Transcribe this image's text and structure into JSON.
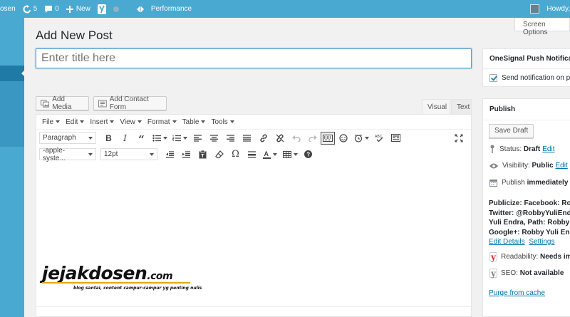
{
  "adminbar": {
    "site_name": "osen",
    "updates_count": "5",
    "comments_count": "0",
    "new_label": "New",
    "performance_label": "Performance",
    "howdy": "Howdy,"
  },
  "screen_options": "Screen Options",
  "page_title": "Add New Post",
  "title_placeholder": "Enter title here",
  "media_buttons": {
    "add_media": "Add Media",
    "add_contact_form": "Add Contact Form"
  },
  "editor_tabs": {
    "visual": "Visual",
    "text": "Text"
  },
  "menubar": [
    "File",
    "Edit",
    "Insert",
    "View",
    "Format",
    "Table",
    "Tools"
  ],
  "toolbar": {
    "format_select": "Paragraph",
    "font_family": "-apple-syste...",
    "font_size": "12pt"
  },
  "logo": {
    "brand": "jejakdosen",
    "tld": ".com",
    "tagline": "blog santai, content campur-campur yg penting nulis"
  },
  "onesignal": {
    "title": "OneSignal Push Notificat",
    "checkbox_label": "Send notification on po"
  },
  "publish": {
    "title": "Publish",
    "save_draft": "Save Draft",
    "status_label": "Status:",
    "status_value": "Draft",
    "visibility_label": "Visibility:",
    "visibility_value": "Public",
    "publish_label": "Publish",
    "publish_value": "immediately",
    "edit_link": "Edit",
    "edit_link_short": "Ed",
    "publicize_1": "Publicize: Facebook: Robby",
    "publicize_2": "Twitter: @RobbyYuliEndra,",
    "publicize_3": "Yuli Endra, Path: Robby Yuli",
    "publicize_4": "Google+: Robby Yuli Endra",
    "edit_details": "Edit Details",
    "settings": "Settings",
    "readability_label": "Readability:",
    "readability_value": "Needs impr",
    "seo_label": "SEO:",
    "seo_value": "Not available",
    "purge": "Purge from cache"
  },
  "colors": {
    "adminbar": "#4aa9d1",
    "sidebar_current": "#1f7aa6",
    "link": "#0073aa"
  }
}
